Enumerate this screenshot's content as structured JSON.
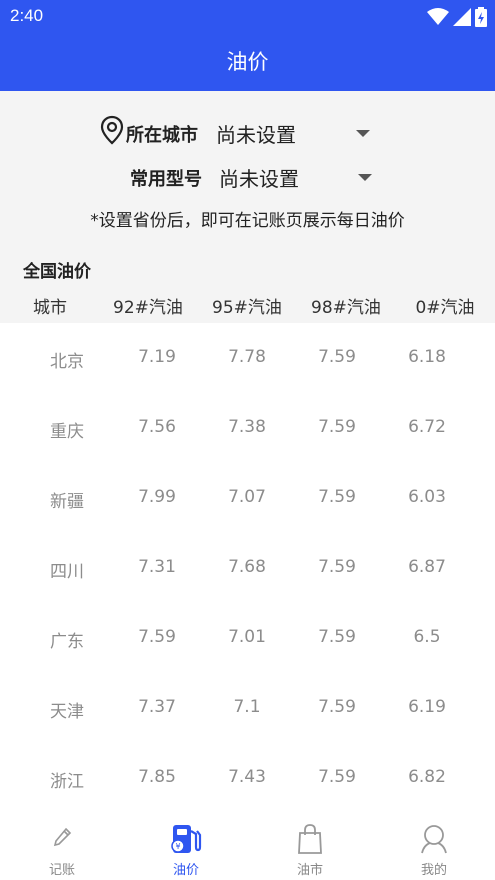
{
  "status_bar": {
    "time": "2:40"
  },
  "header": {
    "title": "油价"
  },
  "settings": {
    "city_label": "所在城市",
    "city_value": "尚未设置",
    "model_label": "常用型号",
    "model_value": "尚未设置",
    "hint": "*设置省份后，即可在记账页展示每日油价"
  },
  "table": {
    "section_title": "全国油价",
    "columns": [
      "城市",
      "92#汽油",
      "95#汽油",
      "98#汽油",
      "0#汽油"
    ],
    "rows": [
      [
        "北京",
        "7.19",
        "7.78",
        "7.59",
        "6.18"
      ],
      [
        "重庆",
        "7.56",
        "7.38",
        "7.59",
        "6.72"
      ],
      [
        "新疆",
        "7.99",
        "7.07",
        "7.59",
        "6.03"
      ],
      [
        "四川",
        "7.31",
        "7.68",
        "7.59",
        "6.87"
      ],
      [
        "广东",
        "7.59",
        "7.01",
        "7.59",
        "6.5"
      ],
      [
        "天津",
        "7.37",
        "7.1",
        "7.59",
        "6.19"
      ],
      [
        "浙江",
        "7.85",
        "7.43",
        "7.59",
        "6.82"
      ]
    ]
  },
  "nav": {
    "items": [
      {
        "label": "记账",
        "icon": "pencil-icon"
      },
      {
        "label": "油价",
        "icon": "fuel-pump-icon"
      },
      {
        "label": "油市",
        "icon": "shopping-bag-icon"
      },
      {
        "label": "我的",
        "icon": "user-icon"
      }
    ],
    "active_index": 1
  },
  "colors": {
    "brand": "#2f56f0",
    "muted": "#8c8c8c"
  }
}
